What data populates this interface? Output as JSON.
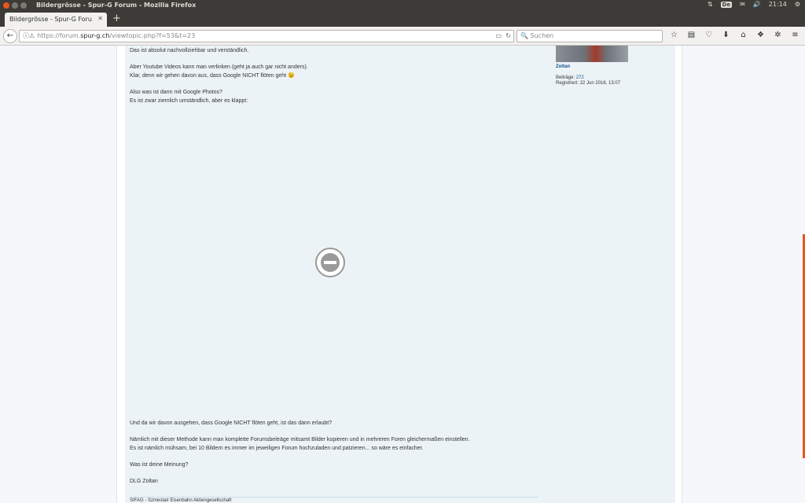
{
  "os": {
    "window_title": "Bildergrösse - Spur-G Forum - Mozilla Firefox",
    "keyboard": "De",
    "clock": "21:14"
  },
  "browser": {
    "tab_title": "Bildergrösse - Spur-G Foru",
    "url_scheme": "https://forum.",
    "url_host": "spur-g.ch",
    "url_path": "/viewtopic.php?f=53&t=23",
    "search_placeholder": "Suchen"
  },
  "post": {
    "paragraphs_top": [
      [
        "Das ist absolut nachvollziehbar und verständlich."
      ],
      [
        "Aber Youtube Videos kann man verlinken (geht ja auch gar nicht anders).",
        "Klar, denn wir gehen davon aus, dass Google NICHT flöten geht 😉"
      ],
      [
        "Also was ist dann mit Google Photos?",
        "Es ist zwar ziemlich umständlich, aber es klappt:"
      ]
    ],
    "paragraphs_bottom": [
      [
        "Und da wir davon ausgehen, dass Google NICHT flöten geht, ist das dann erlaubt?"
      ],
      [
        "Nämlich mit dieser Methode kann man komplette Forumsbeiträge mitsamt Bilder kopieren und in mehreren Foren gleichermaßen einstellen.",
        "Es ist nämlich mühsam, bei 10 Bildern es immer im jeweiligen Forum hochzuladen und patzieren... so wäre es einfacher."
      ],
      [
        "Was ist deine Meinung?"
      ],
      [
        "DLG Zoltan"
      ]
    ],
    "signature": "SIFAG - Szmestalr Eisenbahn Aktiengesellschaft"
  },
  "profile": {
    "username": "Zoltan",
    "posts_label": "Beiträge:",
    "posts_value": "272",
    "registered_label": "Registriert:",
    "registered_value": "22 Jun 2016, 13:07"
  }
}
